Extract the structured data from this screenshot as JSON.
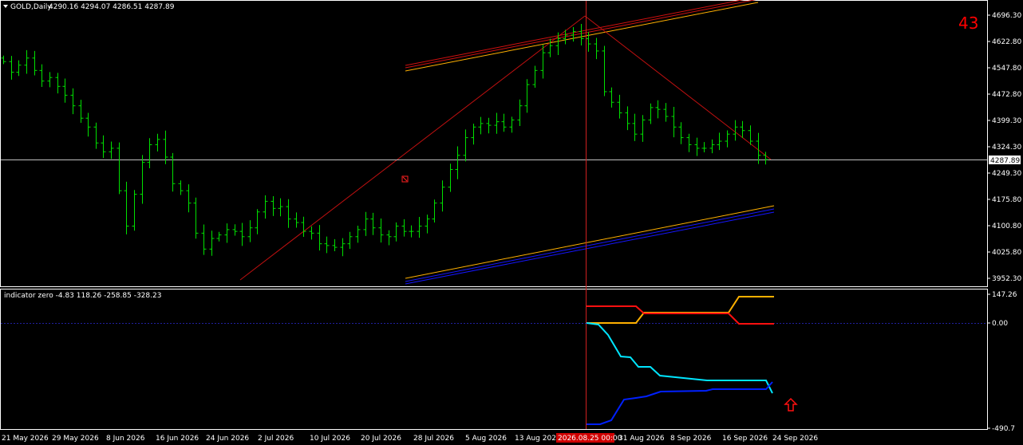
{
  "header": {
    "symbol": "GOLD,Daily",
    "ohlc": "4290.16 4294.07 4286.51 4287.89",
    "counter": "43",
    "menu_icon": "triangle-down-icon"
  },
  "price_axis": {
    "labels": [
      "4696.30",
      "4622.80",
      "4547.80",
      "4472.80",
      "4399.30",
      "4324.30",
      "4249.30",
      "4175.80",
      "4100.80",
      "4025.80",
      "3952.30"
    ],
    "current_price": "4287.89"
  },
  "indicator": {
    "title": "indicator zero -4.83 118.26 -258.85 -328.23",
    "axis_labels": [
      "147.26",
      "0.00",
      "-490.7"
    ]
  },
  "time_axis": {
    "labels": [
      "21 May 2026",
      "29 May 2026",
      "8 Jun 2026",
      "16 Jun 2026",
      "24 Jun 2026",
      "2 Jul 2026",
      "10 Jul 2026",
      "20 Jul 2026",
      "28 Jul 2026",
      "5 Aug 2026",
      "13 Aug 2026",
      "31 Aug 2026",
      "8 Sep 2026",
      "16 Sep 2026",
      "24 Sep 2026"
    ],
    "crosshair_label": "2026.08.25 00:00"
  },
  "colors": {
    "bars": "#00e000",
    "crosshair": "#d02020",
    "price_line": "#c0c0c0",
    "red_line": "#ff0000",
    "orange_line": "#ffb000",
    "cyan_line": "#00e5ff",
    "blue_line": "#0020ff",
    "arrow": "#ff0000"
  },
  "chart_data": {
    "type": "ohlc",
    "symbol": "GOLD",
    "timeframe": "Daily",
    "last": {
      "open": 4290.16,
      "high": 4294.07,
      "low": 4286.51,
      "close": 4287.89
    },
    "close": [
      4565,
      4535,
      4555,
      4575,
      4540,
      4510,
      4520,
      4495,
      4470,
      4440,
      4405,
      4380,
      4335,
      4310,
      4320,
      4200,
      4100,
      4190,
      4280,
      4330,
      4345,
      4295,
      4220,
      4200,
      4165,
      4080,
      4035,
      4065,
      4075,
      4090,
      4085,
      4070,
      4095,
      4140,
      4170,
      4150,
      4155,
      4120,
      4110,
      4085,
      4080,
      4050,
      4045,
      4040,
      4050,
      4070,
      4090,
      4120,
      4095,
      4075,
      4070,
      4100,
      4085,
      4085,
      4100,
      4120,
      4165,
      4210,
      4260,
      4300,
      4350,
      4380,
      4390,
      4385,
      4395,
      4380,
      4400,
      4440,
      4500,
      4540,
      4590,
      4610,
      4630,
      4640,
      4650,
      4630,
      4615,
      4595,
      4480,
      4450,
      4420,
      4390,
      4360,
      4400,
      4435,
      4430,
      4410,
      4380,
      4350,
      4330,
      4320,
      4320,
      4330,
      4340,
      4360,
      4380,
      4370,
      4340,
      4300,
      4288
    ],
    "ylim": [
      3952.3,
      4696.3
    ],
    "indicator": {
      "name": "indicator zero",
      "values": [
        -4.83,
        118.26,
        -258.85,
        -328.23
      ],
      "ylim": [
        -490.7,
        147.26
      ]
    }
  }
}
